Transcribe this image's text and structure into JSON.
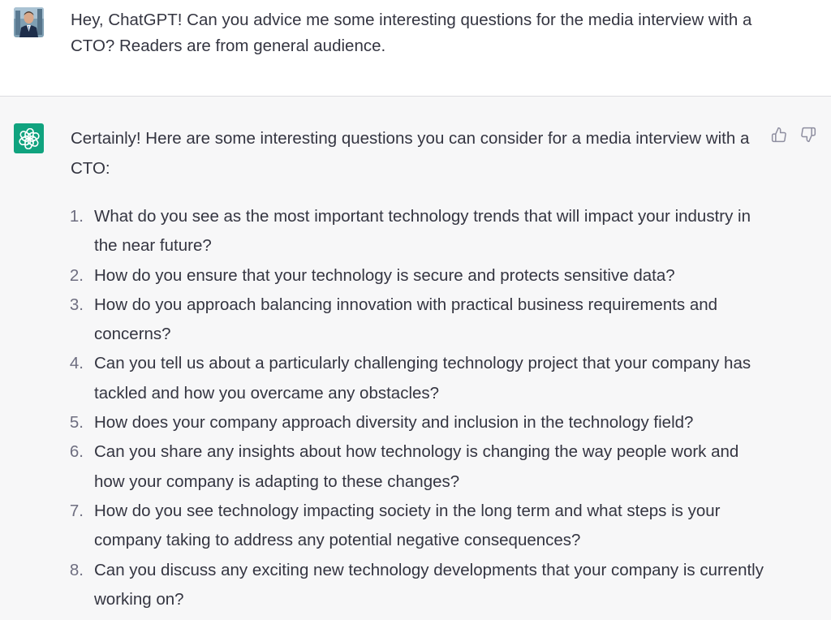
{
  "conversation": {
    "user_message": {
      "text": "Hey, ChatGPT! Can you advice me some interesting questions for the media interview with a CTO? Readers are from general audience."
    },
    "assistant_message": {
      "intro": "Certainly! Here are some interesting questions you can consider for a media interview with a CTO:",
      "questions": [
        {
          "num": "1.",
          "text": "What do you see as the most important technology trends that will impact your industry in the near future?"
        },
        {
          "num": "2.",
          "text": "How do you ensure that your technology is secure and protects sensitive data?"
        },
        {
          "num": "3.",
          "text": "How do you approach balancing innovation with practical business requirements and concerns?"
        },
        {
          "num": "4.",
          "text": "Can you tell us about a particularly challenging technology project that your company has tackled and how you overcame any obstacles?"
        },
        {
          "num": "5.",
          "text": "How does your company approach diversity and inclusion in the technology field?"
        },
        {
          "num": "6.",
          "text": "Can you share any insights about how technology is changing the way people work and how your company is adapting to these changes?"
        },
        {
          "num": "7.",
          "text": "How do you see technology impacting society in the long term and what steps is your company taking to address any potential negative consequences?"
        },
        {
          "num": "8.",
          "text": "Can you discuss any exciting new technology developments that your company is currently working on?"
        }
      ]
    }
  },
  "icons": {
    "user_avatar": "user-photo",
    "assistant_avatar": "openai-logo-icon",
    "feedback_up": "thumbs-up-icon",
    "feedback_down": "thumbs-down-icon"
  },
  "colors": {
    "assistant_avatar_bg": "#10a37f",
    "user_row_bg": "#ffffff",
    "assistant_row_bg": "#f7f7f8",
    "text": "#343541"
  }
}
